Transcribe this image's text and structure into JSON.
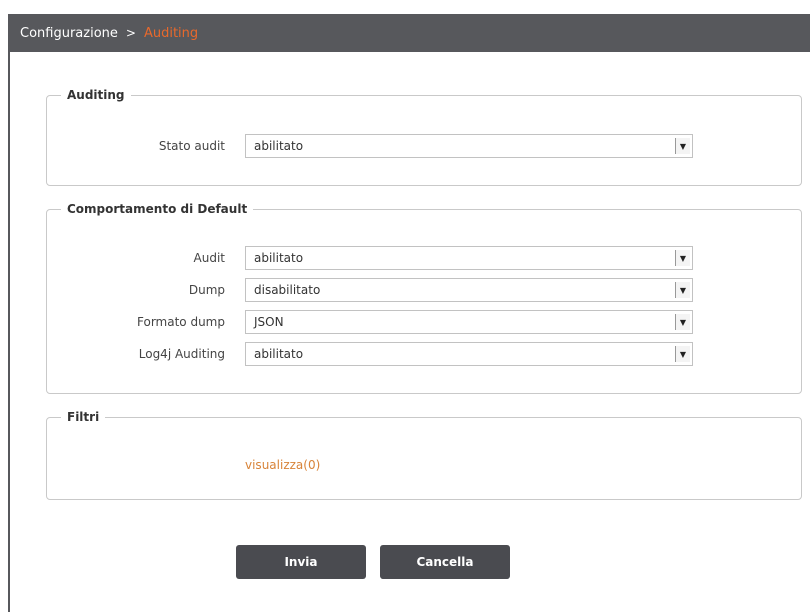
{
  "breadcrumb": {
    "home": "Configurazione",
    "separator": ">",
    "current": "Auditing"
  },
  "auditing": {
    "legend": "Auditing",
    "fields": [
      {
        "label": "Stato audit",
        "value": "abilitato"
      }
    ]
  },
  "default_behavior": {
    "legend": "Comportamento di Default",
    "fields": [
      {
        "label": "Audit",
        "value": "abilitato"
      },
      {
        "label": "Dump",
        "value": "disabilitato"
      },
      {
        "label": "Formato dump",
        "value": "JSON"
      },
      {
        "label": "Log4j Auditing",
        "value": "abilitato"
      }
    ]
  },
  "filters": {
    "legend": "Filtri",
    "link": "visualizza(0)"
  },
  "buttons": {
    "submit": "Invia",
    "cancel": "Cancella"
  },
  "colors": {
    "header_bg": "#57585c",
    "accent": "#e8692c",
    "button_bg": "#4a4b50"
  },
  "icons": {
    "dropdown": "chevron-down-icon",
    "breadcrumb_separator": "chevron-right-icon"
  }
}
